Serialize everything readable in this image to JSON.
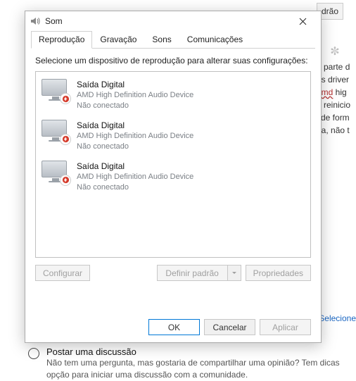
{
  "bg": {
    "button_scrap": "drão",
    "lines": [
      "a parte d",
      "os driver",
      "amd hig",
      "o reinicio",
      "i de form",
      "na, não t"
    ],
    "link_text": "amd",
    "select_label": "Selecione"
  },
  "dialog": {
    "title": "Som",
    "tabs": [
      "Reprodução",
      "Gravação",
      "Sons",
      "Comunicações"
    ],
    "active_tab_index": 0,
    "instructions": "Selecione um dispositivo de reprodução para alterar suas configurações:",
    "devices": [
      {
        "name": "Saída Digital",
        "sub": "AMD High Definition Audio Device",
        "status": "Não conectado"
      },
      {
        "name": "Saída Digital",
        "sub": "AMD High Definition Audio Device",
        "status": "Não conectado"
      },
      {
        "name": "Saída Digital",
        "sub": "AMD High Definition Audio Device",
        "status": "Não conectado"
      }
    ],
    "buttons": {
      "configure": "Configurar",
      "set_default": "Definir padrão",
      "properties": "Propriedades",
      "ok": "OK",
      "cancel": "Cancelar",
      "apply": "Aplicar"
    }
  },
  "discussion": {
    "title": "Postar uma discussão",
    "body": "Não tem uma pergunta, mas gostaria de compartilhar uma opinião? Tem dicas opção para iniciar uma discussão com a comunidade."
  },
  "colors": {
    "accent": "#0078d7",
    "overlay_red": "#d53a2a"
  }
}
